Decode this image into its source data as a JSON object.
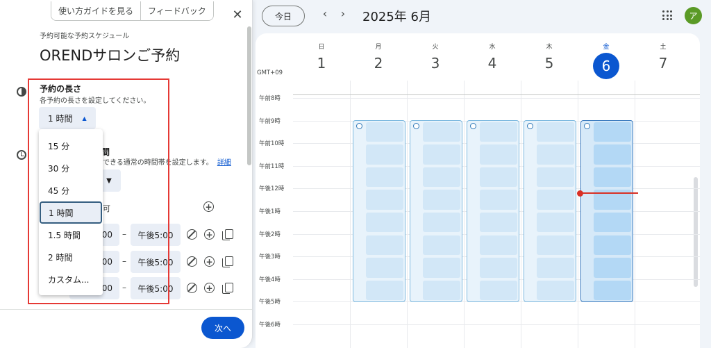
{
  "panel": {
    "guide_button": "使い方ガイドを見る",
    "feedback_button": "フィードバック",
    "close": "✕",
    "schedule_label": "予約可能な予約スケジュール",
    "schedule_title": "ORENDサロンご予約",
    "duration": {
      "title": "予約の長さ",
      "subtitle": "各予約の長さを設定してください。",
      "selected": "1 時間",
      "caret": "▲",
      "options": [
        "15 分",
        "30 分",
        "45 分",
        "1 時間",
        "1.5 時間",
        "2 時間",
        "カスタム..."
      ],
      "selected_index": 3
    },
    "general": {
      "title_fragment": "間",
      "subtitle_fragment": "できる通常の時間帯を設定します。",
      "detail_link": "詳細",
      "tz_caret": "▼",
      "weekly_fragment": "可"
    },
    "time_rows": [
      {
        "start": "00",
        "dash": "–",
        "end": "午後5:00"
      },
      {
        "start": "00",
        "dash": "–",
        "end": "午後5:00"
      },
      {
        "start": "00",
        "dash": "–",
        "end": "午後5:00"
      }
    ],
    "next_button": "次へ"
  },
  "topbar": {
    "today": "今日",
    "prev": "‹",
    "next": "›",
    "month": "2025年 6月",
    "avatar": "ア"
  },
  "calendar": {
    "timezone": "GMT+09",
    "days": [
      {
        "dow": "日",
        "num": "1"
      },
      {
        "dow": "月",
        "num": "2"
      },
      {
        "dow": "火",
        "num": "3"
      },
      {
        "dow": "水",
        "num": "4"
      },
      {
        "dow": "木",
        "num": "5"
      },
      {
        "dow": "金",
        "num": "6"
      },
      {
        "dow": "土",
        "num": "7"
      }
    ],
    "today_index": 5,
    "hours": [
      "午前8時",
      "午前9時",
      "午前10時",
      "午前11時",
      "午後12時",
      "午後1時",
      "午後2時",
      "午後3時",
      "午後4時",
      "午後5時",
      "午後6時"
    ],
    "availability": {
      "day_indices": [
        1,
        2,
        3,
        4,
        5
      ],
      "start": "午前9時",
      "end": "午後5時",
      "slots": 8
    },
    "current_time": "午後12時"
  },
  "colors": {
    "accent": "#0b57d0",
    "now_line": "#d93025",
    "highlight_box": "#e53935"
  }
}
